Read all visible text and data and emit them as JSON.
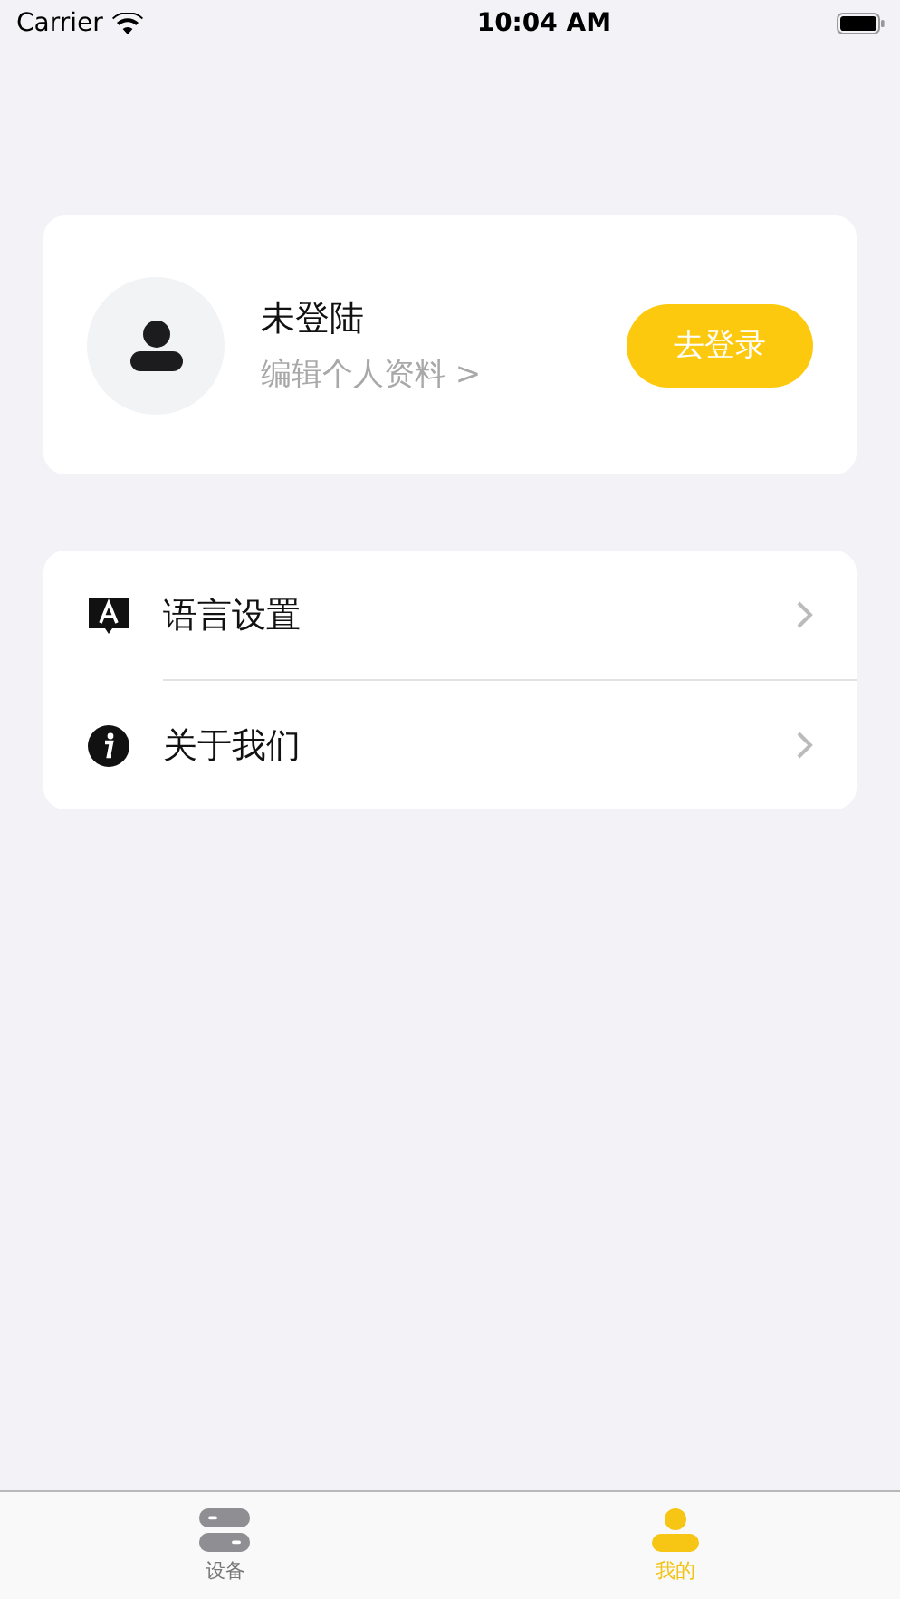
{
  "status_bar": {
    "carrier": "Carrier",
    "time": "10:04 AM"
  },
  "profile": {
    "name": "未登陆",
    "subtitle": "编辑个人资料 >",
    "login_button": "去登录"
  },
  "menu": [
    {
      "kind": "language",
      "label": "语言设置"
    },
    {
      "kind": "about",
      "label": "关于我们"
    }
  ],
  "tab_bar": [
    {
      "kind": "devices",
      "label": "设备",
      "selected": false
    },
    {
      "kind": "me",
      "label": "我的",
      "selected": true
    }
  ]
}
